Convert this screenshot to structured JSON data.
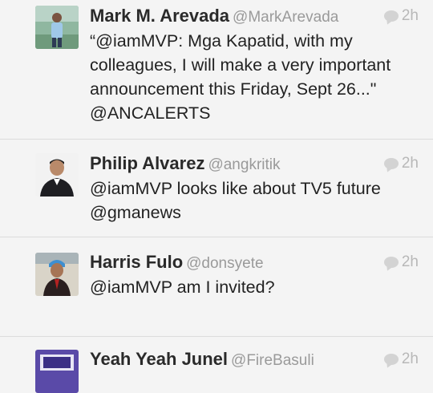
{
  "tweets": [
    {
      "name": "Mark M. Arevada",
      "handle": "@MarkArevada",
      "time": "2h",
      "text": "“@iamMVP: Mga Kapatid, with my colleagues, I will make a very important announcement this Friday, Sept 26...\" @ANCALERTS"
    },
    {
      "name": "Philip Alvarez",
      "handle": "@angkritik",
      "time": "2h",
      "text": "@iamMVP looks like about TV5 future @gmanews"
    },
    {
      "name": "Harris Fulo",
      "handle": "@donsyete",
      "time": "2h",
      "text": "@iamMVP am I invited?"
    },
    {
      "name": "Yeah Yeah Junel",
      "handle": "@FireBasuli",
      "time": "2h",
      "text": ""
    }
  ]
}
